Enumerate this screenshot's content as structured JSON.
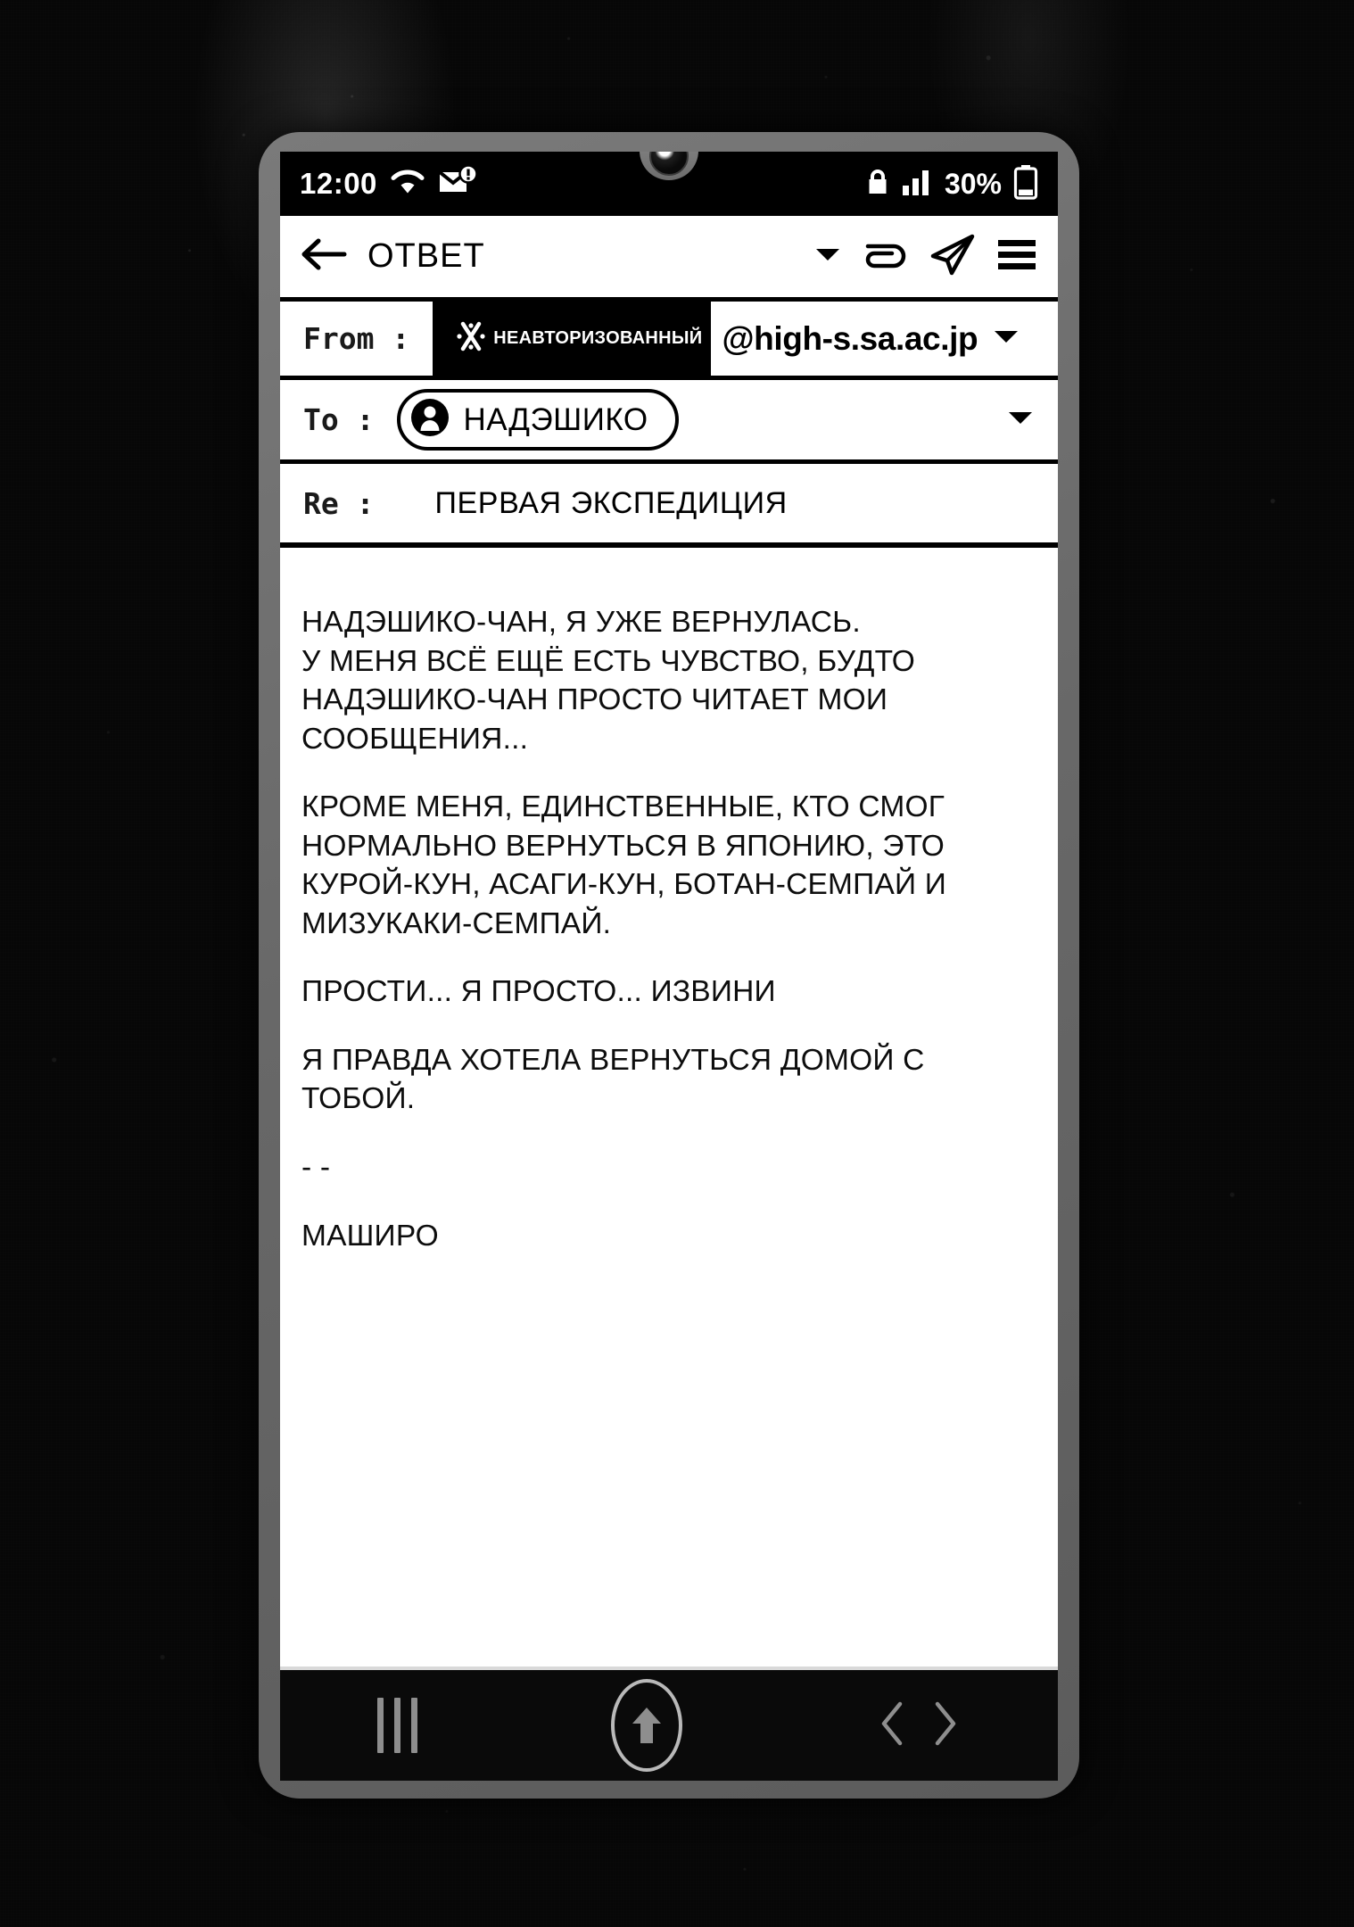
{
  "status_bar": {
    "time": "12:00",
    "wifi_icon": "wifi-icon",
    "mail_alert_icon": "mail-alert-icon",
    "lock_icon": "lock-icon",
    "signal_icon": "signal-bars-icon",
    "battery_percent": "30%",
    "battery_icon": "battery-icon",
    "battery_level": 30
  },
  "toolbar": {
    "back_icon": "back-arrow-icon",
    "title": "ОТВЕТ",
    "dropdown_icon": "chevron-down-icon",
    "attach_icon": "attachment-icon",
    "send_icon": "send-paper-plane-icon",
    "menu_icon": "hamburger-menu-icon"
  },
  "compose": {
    "from": {
      "label": "From :",
      "redacted_icon": "redacted-x-icon",
      "redacted_text": "НЕАВТОРИЗОВАННЫЙ",
      "domain": "@high-s.sa.ac.jp",
      "caret_icon": "chevron-down-icon"
    },
    "to": {
      "label": "To :",
      "avatar_icon": "contact-avatar-icon",
      "recipient": "НАДЭШИКО",
      "caret_icon": "chevron-down-icon"
    },
    "subject": {
      "label": "Re :",
      "value": "ПЕРВАЯ ЭКСПЕДИЦИЯ"
    },
    "body_paragraphs": [
      "НАДЭШИКО-ЧАН, Я УЖЕ ВЕРНУЛАСЬ.\nУ МЕНЯ ВСЁ ЕЩЁ ЕСТЬ ЧУВСТВО, БУДТО\nНАДЭШИКО-ЧАН ПРОСТО ЧИТАЕТ МОИ\nСООБЩЕНИЯ...",
      "КРОМЕ МЕНЯ, ЕДИНСТВЕННЫЕ, КТО СМОГ\nНОРМАЛЬНО ВЕРНУТЬСЯ В ЯПОНИЮ, ЭТО\nКУРОЙ-КУН, АСАГИ-КУН, БОТАН-СЕМПАЙ И\nМИЗУКАКИ-СЕМПАЙ.",
      "ПРОСТИ... Я ПРОСТО... ИЗВИНИ",
      "Я ПРАВДА ХОТЕЛА ВЕРНУТЬСЯ ДОМОЙ С\nТОБОЙ.",
      "- -",
      "МАШИРО"
    ]
  },
  "nav_bar": {
    "recents_icon": "recents-bars-icon",
    "home_icon": "home-up-arrow-icon",
    "back_icon": "angle-left-icon",
    "forward_icon": "angle-right-icon"
  },
  "colors": {
    "screen_white": "#ffffff",
    "screen_black": "#000000",
    "bezel_gray": "#6b6b6b",
    "nav_icon_gray": "#8e8e8e"
  }
}
